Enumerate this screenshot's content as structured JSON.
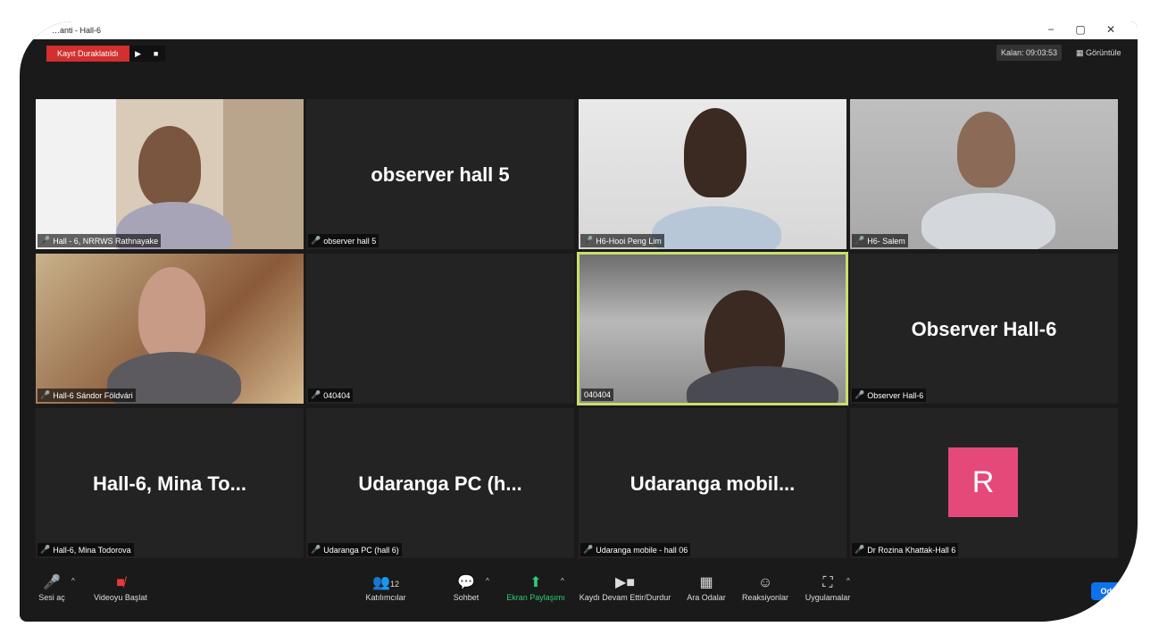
{
  "window": {
    "title": "…anti - Hall-6",
    "controls": {
      "minimize": "−",
      "restore": "▢",
      "close": "✕"
    }
  },
  "recording": {
    "status": "Kayıt Duraklatıldı",
    "play": "▶",
    "stop": "■"
  },
  "header": {
    "timer": "Kalan: 09:03:53",
    "view_label": "Görüntüle",
    "view_icon": "grid-icon"
  },
  "tiles": [
    {
      "name": "Hall - 6, NRRWS Rathnayake",
      "big": "",
      "video": true
    },
    {
      "name": "observer hall 5",
      "big": "observer hall 5",
      "video": false
    },
    {
      "name": "H6-Hooi Peng Lim",
      "big": "",
      "video": true
    },
    {
      "name": "H6- Salem",
      "big": "",
      "video": true
    },
    {
      "name": "Hall-6 Sándor Földvári",
      "big": "",
      "video": true
    },
    {
      "name": "040404",
      "big": "",
      "video": false
    },
    {
      "name": "040404",
      "big": "",
      "video": true,
      "active": true
    },
    {
      "name": "Observer Hall-6",
      "big": "Observer Hall-6",
      "video": false
    },
    {
      "name": "Hall-6, Mina Todorova",
      "big": "Hall-6, Mina To...",
      "video": false
    },
    {
      "name": "Udaranga PC (hall 6)",
      "big": "Udaranga PC (h...",
      "video": false
    },
    {
      "name": "Udaranga mobile - hall 06",
      "big": "Udaranga mobil...",
      "video": false
    },
    {
      "name": "Dr Rozina Khattak-Hall 6",
      "big": "",
      "avatar": "R",
      "video": false
    }
  ],
  "toolbar": {
    "mute": "Sesi aç",
    "video": "Videoyu Başlat",
    "participants": "Katılımcılar",
    "participants_count": "12",
    "chat": "Sohbet",
    "share": "Ekran Paylaşımı",
    "record": "Kaydı Devam Ettir/Durdur",
    "rooms": "Ara Odalar",
    "reactions": "Reaksiyonlar",
    "apps": "Uygulamalar",
    "end": "Oda"
  },
  "colors": {
    "accent_active": "#c8e06b",
    "rec_red": "#d32f2f",
    "share_green": "#2ecc71",
    "avatar_pink": "#e5497a",
    "end_blue": "#0e72ed"
  }
}
